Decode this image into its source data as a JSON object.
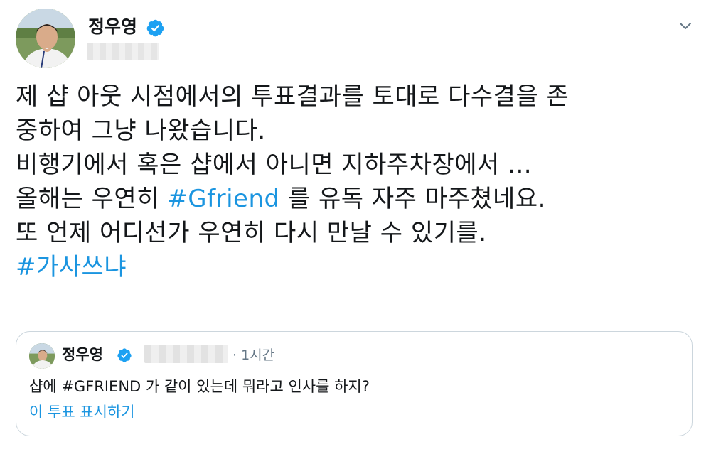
{
  "author": {
    "name": "정우영",
    "verified_icon": "verified-badge-icon",
    "avatar_icon": "profile-photo"
  },
  "menu": {
    "caret_icon": "chevron-down-icon"
  },
  "tweet": {
    "lines": [
      "제 샵 아웃 시점에서의 투표결과를 토대로 다수결을 존",
      "중하여 그냥 나왔습니다.",
      "비행기에서 혹은 샵에서 아니면 지하주차장에서 ...",
      "올해는 우연히 ",
      "#Gfriend",
      " 를 유독 자주 마주쳤네요.",
      "또 언제 어디선가 우연히 다시 만날 수 있기를.",
      "#가사쓰냐"
    ]
  },
  "quoted": {
    "name": "정우영",
    "time": "· 1시간",
    "text": "샵에 #GFRIEND 가 같이 있는데 뭐라고 인사를 하지?",
    "show_thread": "이 투표 표시하기"
  },
  "colors": {
    "link": "#1b95e0",
    "text": "#14171a",
    "muted": "#657786",
    "border": "#ccd6dd",
    "verified": "#1da1f2"
  }
}
